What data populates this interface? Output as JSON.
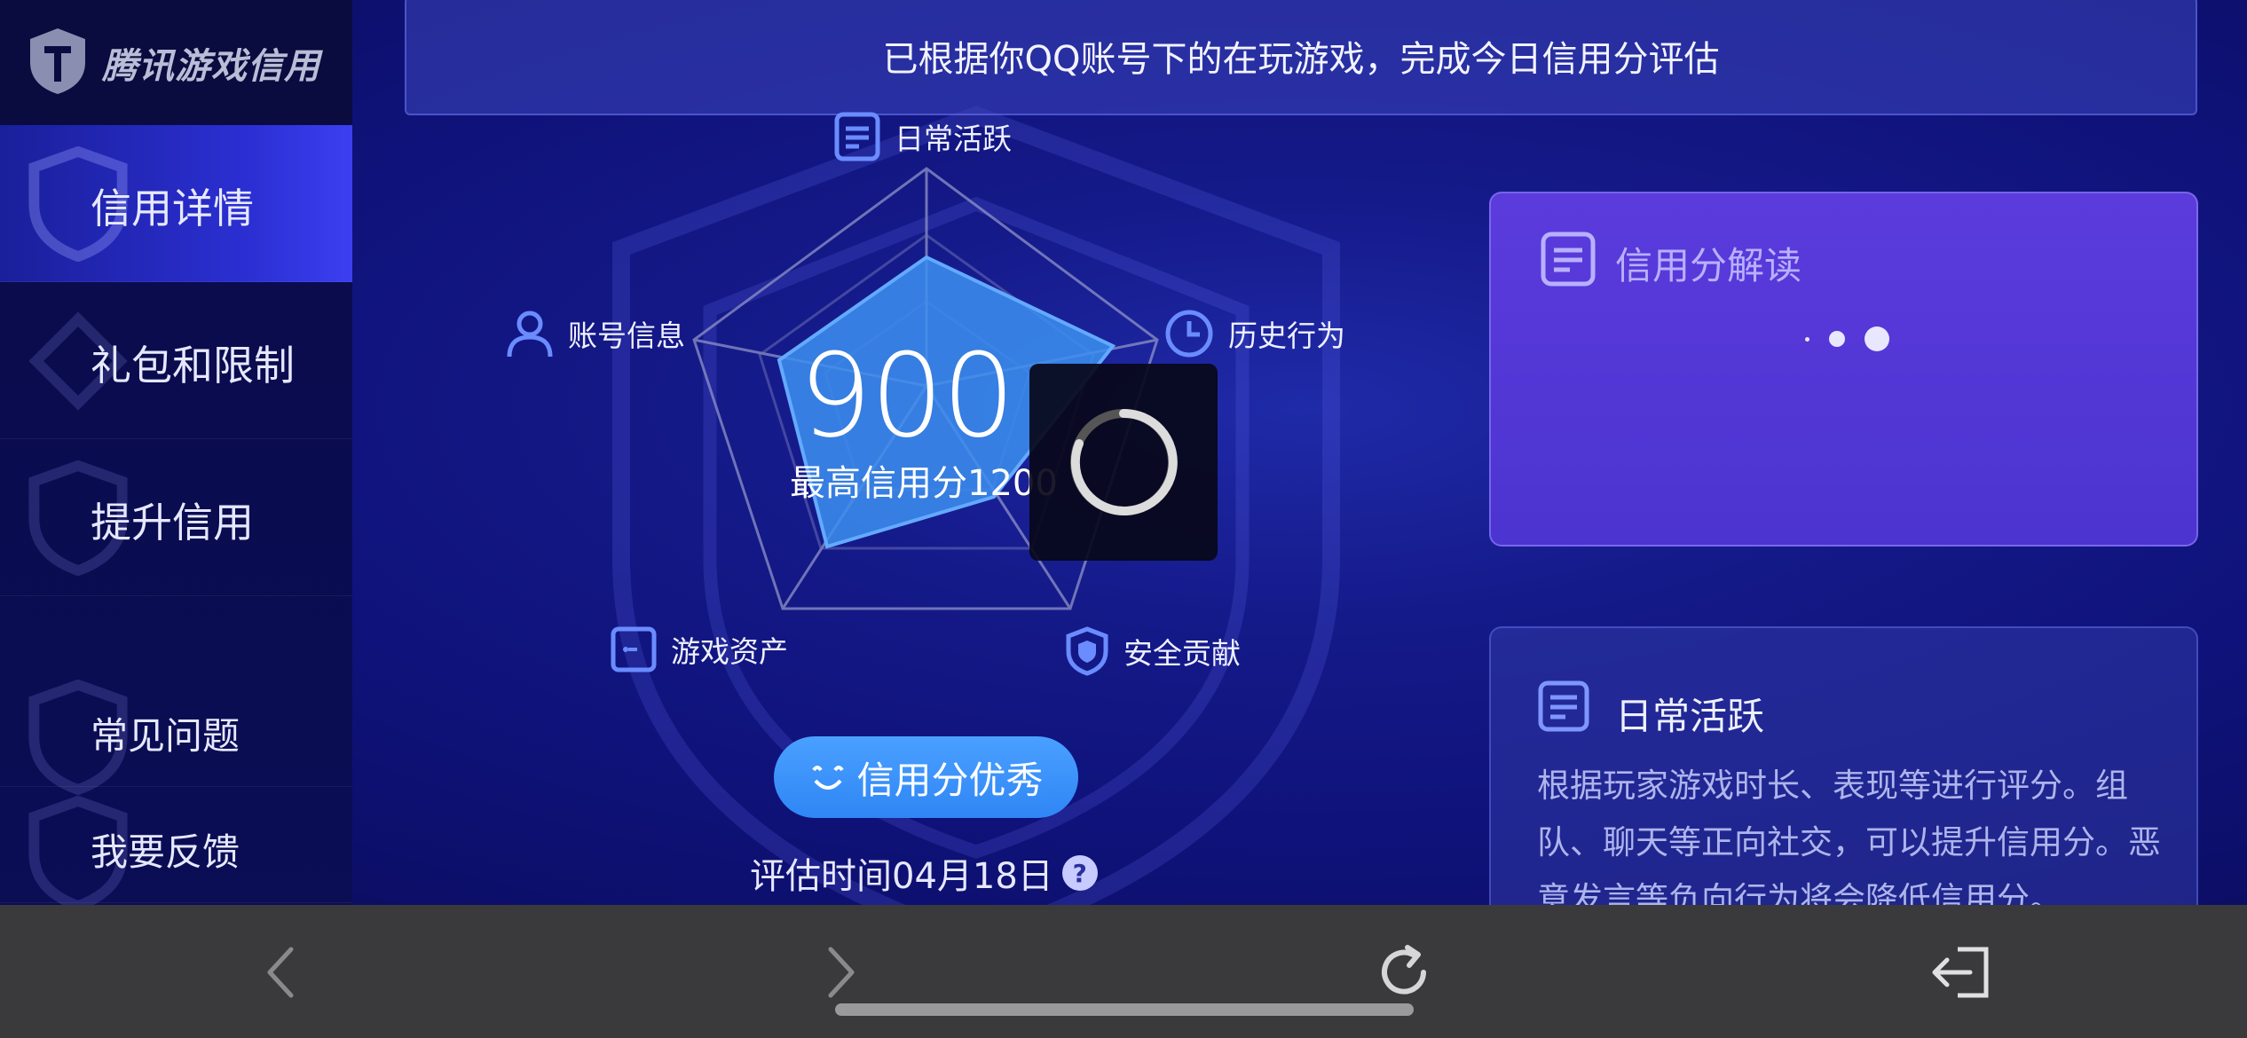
{
  "app": {
    "logo_text": "腾讯游戏信用"
  },
  "sidebar": {
    "items": [
      {
        "label": "信用详情",
        "active": true
      },
      {
        "label": "礼包和限制"
      },
      {
        "label": "提升信用"
      },
      {
        "label": "常见问题"
      },
      {
        "label": "我要反馈"
      }
    ]
  },
  "banner": {
    "text": "已根据你QQ账号下的在玩游戏，完成今日信用分评估"
  },
  "radar": {
    "labels": {
      "daily": "日常活跃",
      "history": "历史行为",
      "security": "安全贡献",
      "assets": "游戏资产",
      "account": "账号信息"
    }
  },
  "score": {
    "value": "900",
    "max_label": "最高信用分1200"
  },
  "badge": {
    "text": "信用分优秀"
  },
  "eval_time": {
    "text": "评估时间04月18日",
    "help": "?"
  },
  "card_interp": {
    "title": "信用分解读"
  },
  "card_daily": {
    "title": "日常活跃",
    "desc": "根据玩家游戏时长、表现等进行评分。组队、聊天等正向社交，可以提升信用分。恶意发言等负向行为将会降低信用分。"
  },
  "toolbar": {
    "back": "back-icon",
    "forward": "forward-icon",
    "refresh": "refresh-icon",
    "exit": "exit-icon"
  },
  "colors": {
    "accent": "#3b8ff7",
    "radar_fill": "#3c8ff0",
    "card_purple": "#5b3bdc",
    "toolbar": "#3a3a3c"
  }
}
